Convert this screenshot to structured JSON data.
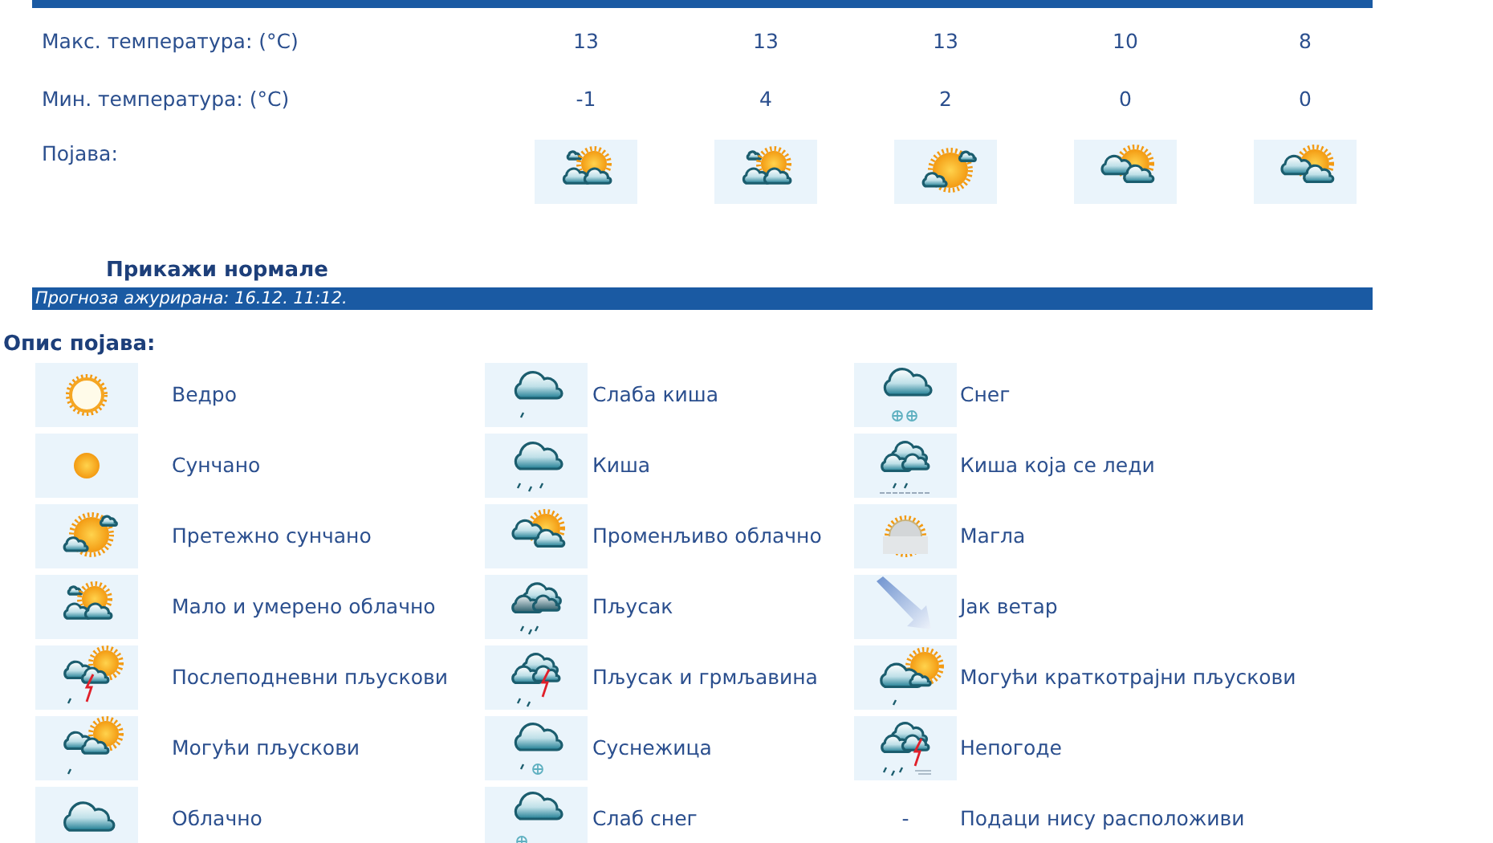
{
  "forecast": {
    "rows": [
      {
        "label": "Макс. температура: (°C)",
        "values": [
          "13",
          "13",
          "13",
          "10",
          "8"
        ]
      },
      {
        "label": "Мин. температура: (°C)",
        "values": [
          "-1",
          "4",
          "2",
          "0",
          "0"
        ]
      }
    ],
    "phenomena": {
      "label": "Појава:",
      "days": [
        {
          "kind": "partly-cloudy"
        },
        {
          "kind": "partly-cloudy"
        },
        {
          "kind": "mostly-sunny"
        },
        {
          "kind": "variable-cloudy"
        },
        {
          "kind": "variable-cloudy"
        }
      ]
    }
  },
  "normals_link": "Прикажи нормале",
  "updated": "Прогноза ажурирана:  16.12. 11:12.",
  "legend": {
    "title": "Опис појава:",
    "columns": [
      [
        {
          "kind": "clear",
          "label": "Ведро"
        },
        {
          "kind": "sunny",
          "label": "Сунчано"
        },
        {
          "kind": "mostly-sunny",
          "label": "Претежно сунчано"
        },
        {
          "kind": "partly-cloudy",
          "label": "Мало и умерено облачно"
        },
        {
          "kind": "afternoon-showers",
          "label": "Послеподневни пљускови"
        },
        {
          "kind": "possible-showers",
          "label": "Могући пљускови"
        },
        {
          "kind": "cloudy",
          "label": "Облачно"
        }
      ],
      [
        {
          "kind": "light-rain",
          "label": "Слаба киша"
        },
        {
          "kind": "rain",
          "label": "Киша"
        },
        {
          "kind": "variable-cloudy",
          "label": "Променљиво облачно"
        },
        {
          "kind": "showers",
          "label": "Пљусак"
        },
        {
          "kind": "thunderstorm",
          "label": "Пљусак и грмљавина"
        },
        {
          "kind": "sleet",
          "label": "Суснежица"
        },
        {
          "kind": "light-snow",
          "label": "Слаб снег"
        }
      ],
      [
        {
          "kind": "snow",
          "label": "Снег"
        },
        {
          "kind": "freezing-rain",
          "label": "Киша која се леди"
        },
        {
          "kind": "fog",
          "label": "Магла"
        },
        {
          "kind": "wind",
          "label": "Јак ветар"
        },
        {
          "kind": "short-showers",
          "label": "Могући краткотрајни пљускови"
        },
        {
          "kind": "severe",
          "label": "Непогоде"
        },
        {
          "kind": "none",
          "symbol": "-",
          "label": "Подаци нису расположиви"
        }
      ]
    ]
  }
}
